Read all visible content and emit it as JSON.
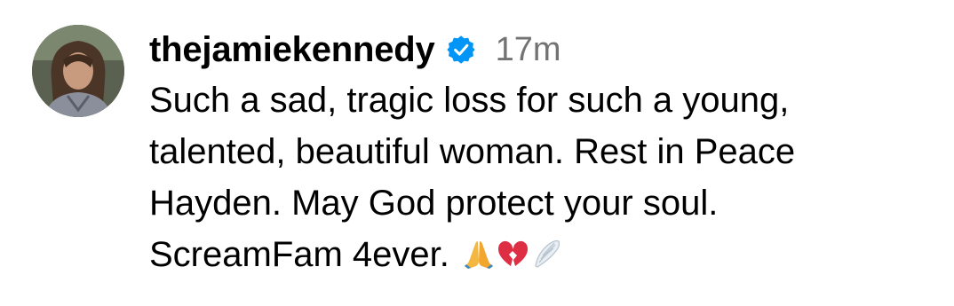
{
  "comment": {
    "username": "thejamiekennedy",
    "verified": true,
    "timestamp": "17m",
    "text": "Such a sad, tragic loss for such a young,\ntalented, beautiful woman. Rest in Peace\nHayden. May God protect your soul.\nScreamFam 4ever.",
    "emojis": [
      "folded-hands-icon",
      "broken-heart-icon",
      "wing-icon"
    ]
  },
  "colors": {
    "verified_badge": "#0095F6",
    "timestamp": "#737373",
    "text": "#000000",
    "background": "#FFFFFF"
  }
}
